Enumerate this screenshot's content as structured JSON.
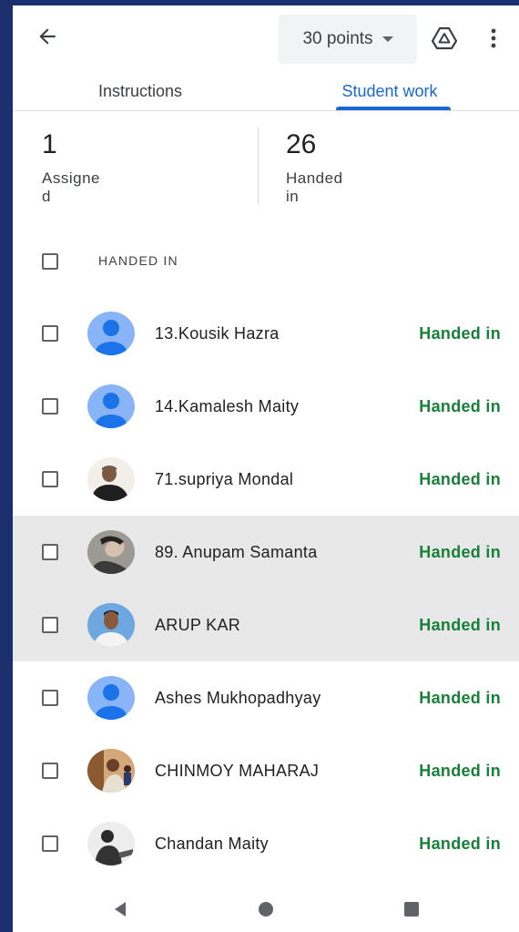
{
  "header": {
    "back_icon": "arrow-back-icon",
    "points_label": "30 points",
    "drive_icon": "google-drive-icon",
    "more_icon": "more-vert-icon"
  },
  "tabs": [
    {
      "label": "Instructions",
      "active": false
    },
    {
      "label": "Student work",
      "active": true
    }
  ],
  "stats": {
    "assigned": {
      "count": "1",
      "label_line1": "Assigne",
      "label_line2": "d"
    },
    "handed_in": {
      "count": "26",
      "label_line1": "Handed",
      "label_line2": "in"
    }
  },
  "section": {
    "title": "HANDED IN"
  },
  "students": [
    {
      "name": "13.Kousik Hazra",
      "status": "Handed in",
      "avatar": "default"
    },
    {
      "name": "14.Kamalesh Maity",
      "status": "Handed in",
      "avatar": "default"
    },
    {
      "name": "71.supriya Mondal",
      "status": "Handed in",
      "avatar": "photo"
    },
    {
      "name": "89. Anupam Samanta",
      "status": "Handed in",
      "avatar": "photo"
    },
    {
      "name": "ARUP KAR",
      "status": "Handed in",
      "avatar": "photo"
    },
    {
      "name": "Ashes Mukhopadhyay",
      "status": "Handed in",
      "avatar": "default"
    },
    {
      "name": "CHINMOY MAHARAJ",
      "status": "Handed in",
      "avatar": "photo"
    },
    {
      "name": "Chandan Maity",
      "status": "Handed in",
      "avatar": "photo"
    }
  ],
  "colors": {
    "accent": "#1967d2",
    "status_green": "#188038",
    "avatar_default_bg": "#8ab4f8",
    "avatar_default_fg": "#1a73e8",
    "selected_row_bg": "#e8e8e8"
  },
  "navbar": {
    "back_icon": "nav-back-triangle-icon",
    "home_icon": "nav-home-circle-icon",
    "recents_icon": "nav-recents-square-icon"
  }
}
